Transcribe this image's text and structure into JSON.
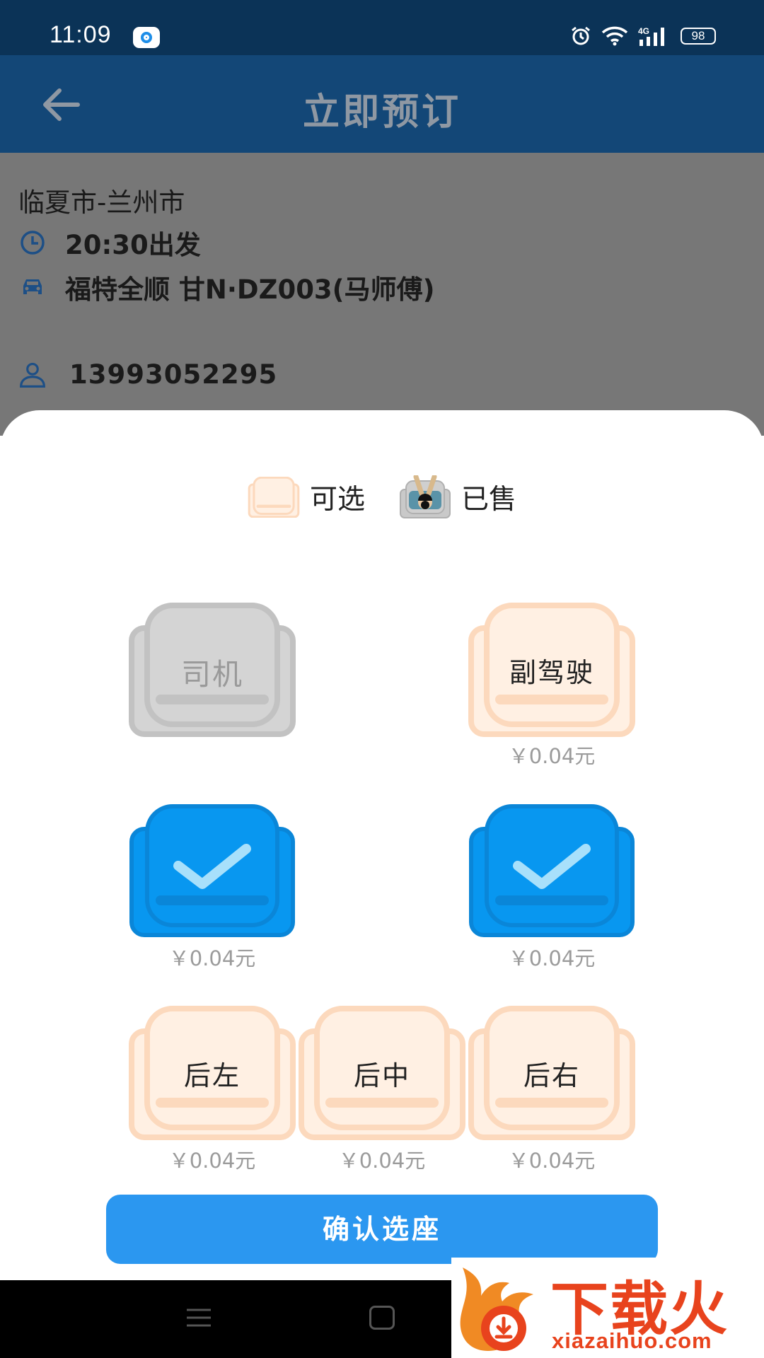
{
  "status_bar": {
    "time": "11:09",
    "network": "4G",
    "battery": "98"
  },
  "header": {
    "title": "立即预订"
  },
  "trip": {
    "route": "临夏市-兰州市",
    "departure": "20:30出发",
    "vehicle": "福特全顺 甘N·DZ003(马师傅)",
    "phone": "13993052295"
  },
  "legend": {
    "available": "可选",
    "sold": "已售"
  },
  "seats": {
    "driver": {
      "label": "司机"
    },
    "copilot": {
      "label": "副驾驶",
      "price": "￥0.04元"
    },
    "mid_left": {
      "price": "￥0.04元",
      "selected": true
    },
    "mid_right": {
      "price": "￥0.04元",
      "selected": true
    },
    "back_left": {
      "label": "后左",
      "price": "￥0.04元"
    },
    "back_middle": {
      "label": "后中",
      "price": "￥0.04元"
    },
    "back_right": {
      "label": "后右",
      "price": "￥0.04元"
    }
  },
  "confirm_button": "确认选座",
  "watermark": {
    "text": "下载火",
    "url": "xiazaihuo.com"
  },
  "colors": {
    "status_bar": "#0b3357",
    "header": "#134777",
    "seat_available_fill": "#fff0e3",
    "seat_available_stroke": "#fcd9bd",
    "seat_selected": "#0897f0",
    "seat_driver": "#d4d4d4",
    "confirm_button": "#2b97f0",
    "watermark": "#e8431d"
  }
}
